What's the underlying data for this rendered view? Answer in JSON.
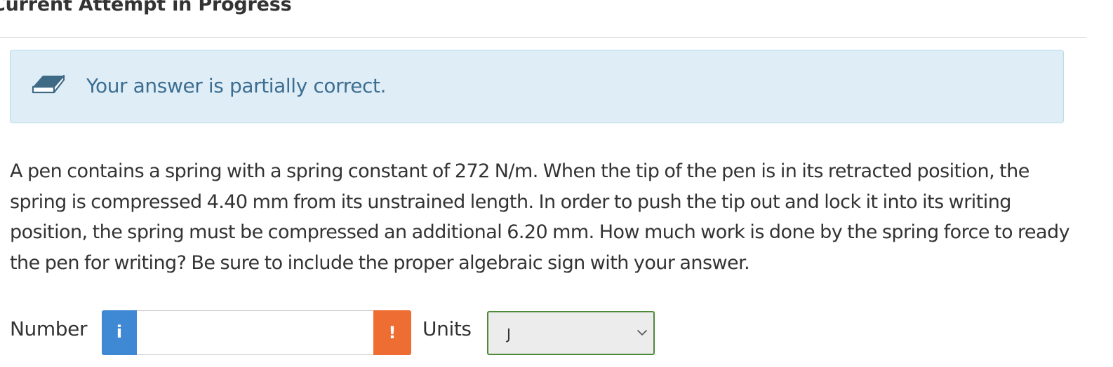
{
  "header": {
    "title": "Current Attempt in Progress"
  },
  "feedback": {
    "icon": "eraser-icon",
    "message": "Your answer is partially correct.",
    "colors": {
      "background": "#dfedf7",
      "border": "#b6dde9",
      "text": "#3c6e91"
    }
  },
  "question": {
    "text": "A pen contains a spring with a spring constant of 272 N/m. When the tip of the pen is in its retracted position, the spring is compressed 4.40 mm from its unstrained length. In order to push the tip out and lock it into its writing position, the spring must be compressed an additional 6.20 mm. How much work is done by the spring force to ready the pen for writing? Be sure to include the proper algebraic sign with your answer."
  },
  "answer": {
    "number_label": "Number",
    "info_button": "i",
    "number_value": "",
    "warning_button": "!",
    "units_label": "Units",
    "units_selected": "J",
    "colors": {
      "info": "#3f88d4",
      "warning": "#ee6d33",
      "select_border": "#4f8a3b"
    }
  }
}
